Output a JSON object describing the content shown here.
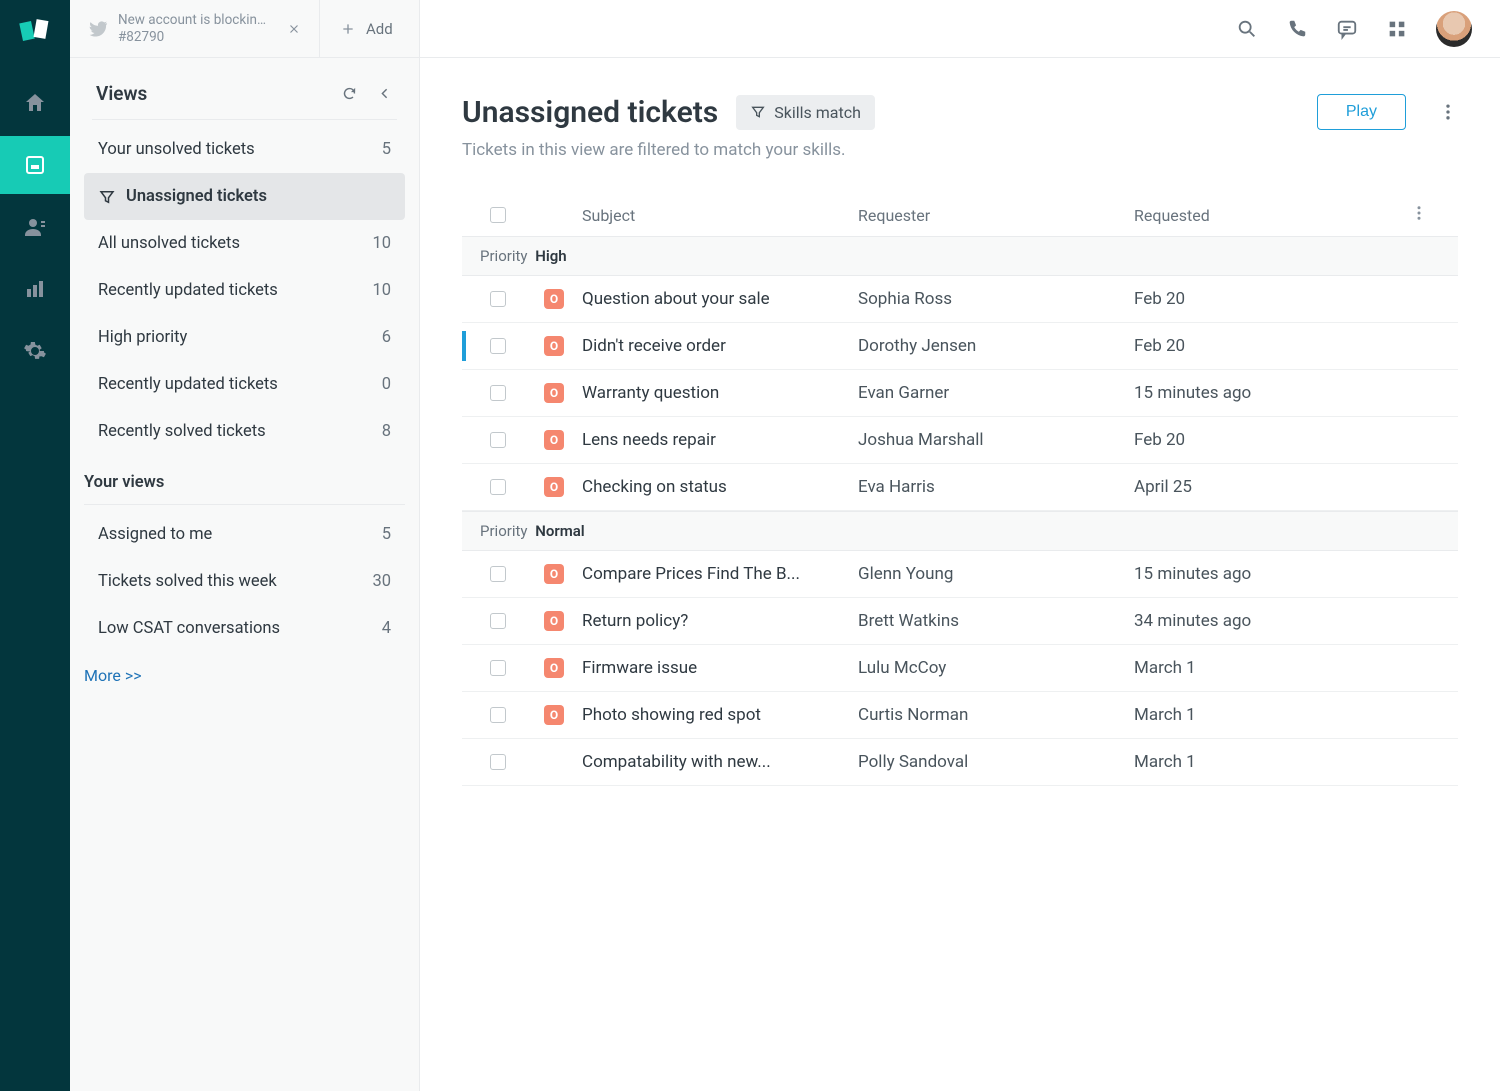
{
  "rail": {
    "items": [
      "home",
      "views",
      "customers",
      "reports",
      "settings"
    ],
    "active": 1
  },
  "tab": {
    "title": "New account is blocking...",
    "subtitle": "#82790"
  },
  "addLabel": "Add",
  "viewsPanel": {
    "header": "Views",
    "items": [
      {
        "label": "Your unsolved tickets",
        "count": "5"
      },
      {
        "label": "Unassigned tickets",
        "count": "",
        "active": true,
        "icon": true
      },
      {
        "label": "All unsolved tickets",
        "count": "10"
      },
      {
        "label": "Recently updated tickets",
        "count": "10"
      },
      {
        "label": "High priority",
        "count": "6"
      },
      {
        "label": "Recently updated tickets",
        "count": "0"
      },
      {
        "label": "Recently solved tickets",
        "count": "8"
      }
    ],
    "yourViewsLabel": "Your views",
    "yourViews": [
      {
        "label": "Assigned to me",
        "count": "5"
      },
      {
        "label": "Tickets solved this week",
        "count": "30"
      },
      {
        "label": "Low CSAT conversations",
        "count": "4"
      }
    ],
    "more": "More >>"
  },
  "main": {
    "title": "Unassigned tickets",
    "skillsChip": "Skills match",
    "play": "Play",
    "subtitle": "Tickets in this view are filtered to match your skills.",
    "columns": {
      "subject": "Subject",
      "requester": "Requester",
      "requested": "Requested"
    },
    "groups": [
      {
        "priorityLabel": "Priority",
        "priorityValue": "High",
        "rows": [
          {
            "badge": "O",
            "subject": "Question about your sale",
            "requester": "Sophia Ross",
            "requested": "Feb 20"
          },
          {
            "badge": "O",
            "subject": "Didn't receive order",
            "requester": "Dorothy Jensen",
            "requested": "Feb 20",
            "marker": true
          },
          {
            "badge": "O",
            "subject": "Warranty question",
            "requester": "Evan Garner",
            "requested": "15 minutes ago"
          },
          {
            "badge": "O",
            "subject": "Lens needs repair",
            "requester": "Joshua Marshall",
            "requested": "Feb 20"
          },
          {
            "badge": "O",
            "subject": "Checking on status",
            "requester": "Eva Harris",
            "requested": "April 25"
          }
        ]
      },
      {
        "priorityLabel": "Priority",
        "priorityValue": "Normal",
        "rows": [
          {
            "badge": "O",
            "subject": "Compare Prices Find The B...",
            "requester": "Glenn Young",
            "requested": "15 minutes ago"
          },
          {
            "badge": "O",
            "subject": "Return policy?",
            "requester": "Brett Watkins",
            "requested": "34 minutes ago"
          },
          {
            "badge": "O",
            "subject": "Firmware issue",
            "requester": "Lulu McCoy",
            "requested": "March 1"
          },
          {
            "badge": "O",
            "subject": "Photo showing red spot",
            "requester": "Curtis Norman",
            "requested": "March 1"
          },
          {
            "badge": "",
            "subject": "Compatability with new...",
            "requester": "Polly Sandoval",
            "requested": "March 1"
          }
        ]
      }
    ]
  }
}
